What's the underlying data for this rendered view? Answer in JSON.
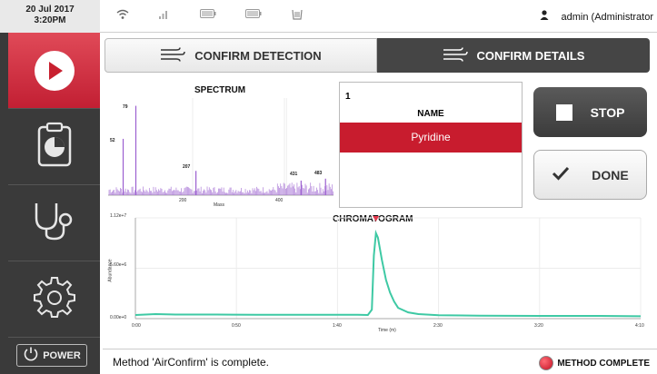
{
  "status_bar": {
    "date": "20 Jul 2017",
    "time": "3:20PM",
    "user": "admin (Administrator"
  },
  "sidebar": {
    "power_label": "POWER"
  },
  "tabs": [
    {
      "label": "CONFIRM DETECTION",
      "active": false
    },
    {
      "label": "CONFIRM DETAILS",
      "active": true
    }
  ],
  "result": {
    "index": "1",
    "header": "NAME",
    "name": "Pyridine"
  },
  "actions": {
    "stop_label": "STOP",
    "done_label": "DONE"
  },
  "footer": {
    "message": "Method 'AirConfirm' is complete.",
    "status": "METHOD COMPLETE"
  },
  "colors": {
    "accent_red": "#c81c2e",
    "sidebar_dark": "#3a3a3a",
    "spectrum_purple": "#9b5fd0",
    "chromatogram_teal": "#3ec9a4"
  },
  "chart_data": [
    {
      "type": "bar",
      "title": "SPECTRUM",
      "xlabel": "Mass",
      "ylabel": "",
      "xlim": [
        20,
        500
      ],
      "x_ticks": [
        "200",
        "400"
      ],
      "grid": true,
      "peak_labels": [
        "52",
        "79",
        "207",
        "431",
        "483"
      ],
      "peaks": [
        {
          "mz": 52,
          "intensity": 0.58
        },
        {
          "mz": 79,
          "intensity": 0.92
        },
        {
          "mz": 207,
          "intensity": 0.25
        },
        {
          "mz": 431,
          "intensity": 0.15
        },
        {
          "mz": 483,
          "intensity": 0.17
        }
      ]
    },
    {
      "type": "line",
      "title": "CHROMATOGRAM",
      "xlabel": "Time (m)",
      "ylabel": "Abundance",
      "x_ticks": [
        "0:00",
        "0:50",
        "1:40",
        "2:30",
        "3:20",
        "4:10"
      ],
      "y_ticks": [
        "1.12e+7",
        "5.60e+6",
        "0.00e+0"
      ],
      "xlim": [
        0,
        250
      ],
      "ylim": [
        0,
        11200000
      ],
      "grid": true,
      "series": [
        {
          "x": [
            0,
            10,
            20,
            40,
            60,
            80,
            100,
            110,
            115,
            117,
            118,
            119,
            120,
            122,
            124,
            126,
            128,
            130,
            135,
            140,
            150,
            170,
            200,
            230,
            250
          ],
          "y": [
            400000,
            500000,
            450000,
            450000,
            420000,
            430000,
            420000,
            420000,
            400000,
            1000000,
            7000000,
            9500000,
            9000000,
            6500000,
            4300000,
            2900000,
            1900000,
            1200000,
            700000,
            500000,
            380000,
            320000,
            300000,
            300000,
            260000
          ]
        }
      ],
      "peak_marker_x": 119
    }
  ]
}
